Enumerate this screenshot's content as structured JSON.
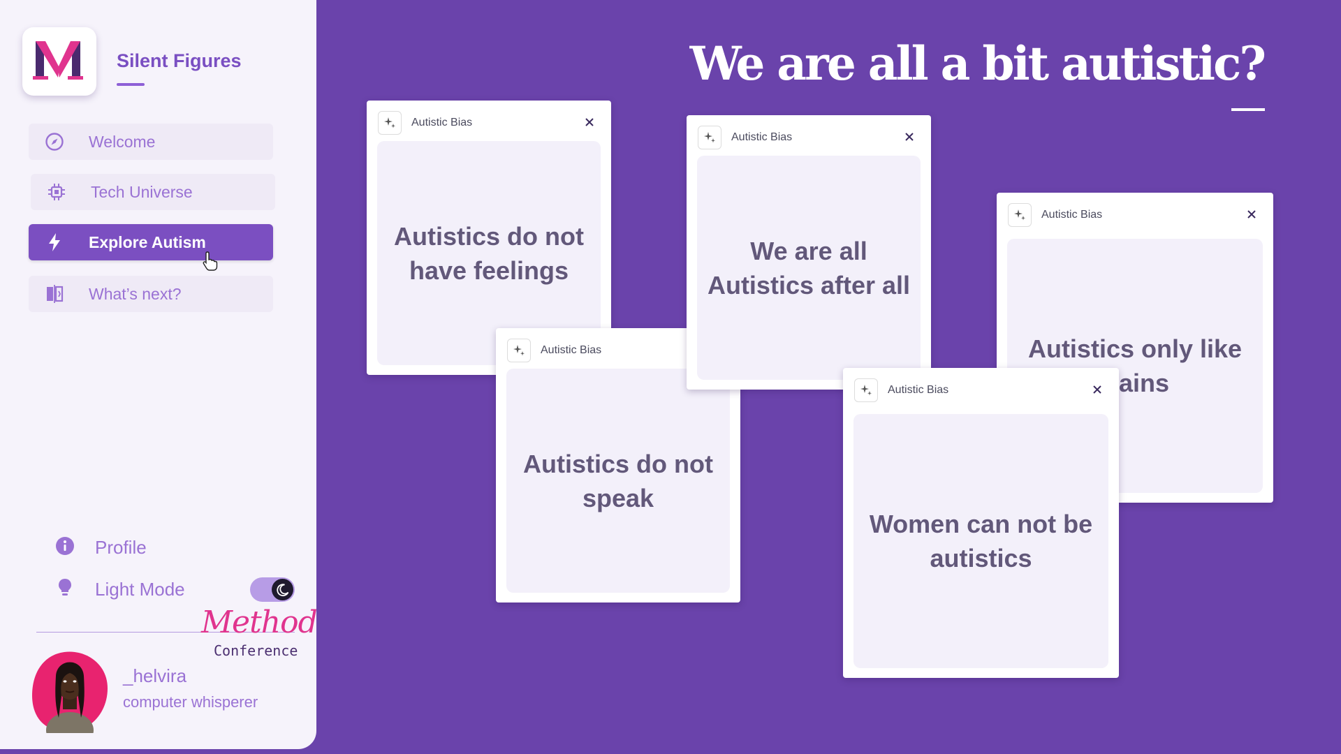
{
  "sidebar": {
    "brand_name": "Silent Figures",
    "logo_letter": "M",
    "nav": [
      {
        "label": "Welcome",
        "icon": "compass-icon"
      },
      {
        "label": "Tech Universe",
        "icon": "cpu-chip-icon"
      },
      {
        "label": "Explore Autism",
        "icon": "lightning-bolt-icon",
        "active": true
      },
      {
        "label": "What’s next?",
        "icon": "split-arrows-icon"
      }
    ],
    "profile_label": "Profile",
    "light_mode_label": "Light Mode",
    "light_mode_on": true,
    "conference": {
      "script": "Method",
      "word": "Conference"
    },
    "user": {
      "handle": "_helvira",
      "role": "computer whisperer"
    }
  },
  "main": {
    "title": "We are all a bit autistic?",
    "cards": [
      {
        "tag": "Autistic Bias",
        "text": "Autistics do not have feelings"
      },
      {
        "tag": "Autistic Bias",
        "text": "Autistics do not speak"
      },
      {
        "tag": "Autistic Bias",
        "text": "We are all Autistics after all"
      },
      {
        "tag": "Autistic Bias",
        "text": "Autistics only like trains"
      },
      {
        "tag": "Autistic Bias",
        "text": "Women can not be autistics"
      }
    ]
  },
  "colors": {
    "background": "#6a43ab",
    "sidebar": "#f6f3fb",
    "accent": "#7b4fc1",
    "logo_pink": "#e0348e",
    "logo_dark": "#4a2a6e"
  }
}
